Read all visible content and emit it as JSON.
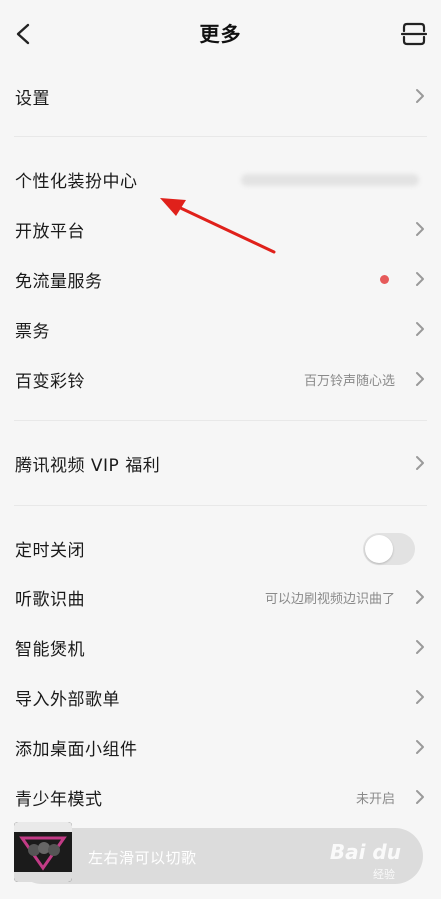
{
  "header": {
    "title": "更多"
  },
  "sections": {
    "settings": "设置",
    "personalize": "个性化装扮中心",
    "open_platform": "开放平台",
    "free_data": "免流量服务",
    "tickets": "票务",
    "ringtone": {
      "label": "百变彩铃",
      "hint": "百万铃声随心选"
    },
    "tencent_video": "腾讯视频 VIP 福利",
    "timer": "定时关闭",
    "song_recognition": {
      "label": "听歌识曲",
      "hint": "可以边刷视频边识曲了"
    },
    "smart_device": "智能煲机",
    "import_playlist": "导入外部歌单",
    "widget": "添加桌面小组件",
    "teen_mode": {
      "label": "青少年模式",
      "hint": "未开启"
    }
  },
  "player": {
    "prompt": "左右滑可以切歌"
  },
  "watermark": {
    "brand": "Bai du",
    "sub": "经验"
  },
  "colors": {
    "accent_dot": "#e65a5a",
    "annotation_arrow": "#e0211b"
  },
  "toggles": {
    "timer": false
  }
}
